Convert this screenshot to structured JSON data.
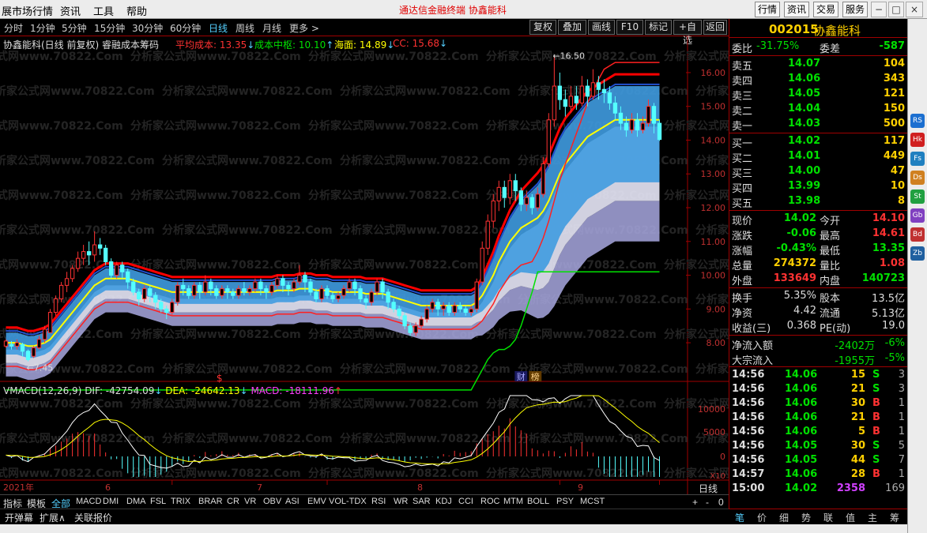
{
  "menu": {
    "items": [
      "展市场行情",
      "资讯",
      "工具",
      "帮助"
    ],
    "center_title": "通达信金融终端    协鑫能科",
    "right_buttons": [
      "行情",
      "资讯",
      "交易",
      "服务"
    ],
    "window_buttons": [
      "−",
      "□",
      "×"
    ]
  },
  "periods": {
    "items": [
      "分时",
      "1分钟",
      "5分钟",
      "15分钟",
      "30分钟",
      "60分钟",
      "日线",
      "周线",
      "月线",
      "更多 >"
    ],
    "active": "日线"
  },
  "toolbar": [
    "复权",
    "叠加",
    "画线",
    "F10",
    "标记",
    "+自选",
    "返回"
  ],
  "chart_header": {
    "title": "协鑫能科(日线 前复权) 睿融成本筹码",
    "avg_cost": "平均成本: 13.35",
    "cost_center": "成本中枢: 10.10",
    "sea": "海面: 14.89",
    "cc": "CC: 15.68"
  },
  "price_axis": [
    "16.00",
    "15.00",
    "14.00",
    "13.00",
    "12.00",
    "11.00",
    "10.00",
    "9.00",
    "8.00"
  ],
  "macd_axis": [
    "10000",
    "5000",
    "0"
  ],
  "macd_axis_unit": "X10",
  "annotations": {
    "high": "16.50",
    "low": "7.45",
    "dollar": "$",
    "badge_cai": "财",
    "badge_bang": "榜"
  },
  "x_labels": {
    "year": "2021年",
    "months": [
      "6",
      "7",
      "8",
      "9"
    ],
    "period": "日线"
  },
  "macd_header": {
    "name": "VMACD(12,26,9)",
    "dif": "DIF: -42754.09",
    "dea": "DEA: -24642.13",
    "macd": "MACD: -18111.96"
  },
  "watermark": "分析家公式网www.70822.Com",
  "colors": {
    "up": "#ff3232",
    "down": "#54ffff",
    "yellow": "#ffff00",
    "green_line": "#00e000",
    "red_line": "#ff0000",
    "blue_band": "#3f9be0",
    "lavender": "#a8a8e0",
    "accent_yellow": "#ffd000",
    "panel_border": "#a00000"
  },
  "chart_data": {
    "type": "candlestick",
    "ylim": [
      7.3,
      16.7
    ],
    "candles": [
      [
        7.9,
        8.05,
        7.85,
        8.1
      ],
      [
        7.95,
        7.9,
        7.8,
        8.05
      ],
      [
        7.9,
        8.0,
        7.8,
        8.1
      ],
      [
        7.95,
        7.75,
        7.6,
        8.0
      ],
      [
        7.75,
        7.5,
        7.45,
        7.8
      ],
      [
        7.6,
        7.85,
        7.55,
        7.9
      ],
      [
        7.85,
        8.1,
        7.8,
        8.2
      ],
      [
        8.1,
        8.4,
        8.0,
        8.5
      ],
      [
        8.3,
        8.9,
        8.3,
        9.0
      ],
      [
        8.9,
        9.3,
        8.8,
        9.4
      ],
      [
        9.3,
        9.7,
        9.2,
        9.8
      ],
      [
        9.7,
        9.9,
        9.5,
        10.1
      ],
      [
        9.9,
        10.2,
        9.8,
        10.3
      ],
      [
        10.2,
        10.5,
        10.1,
        10.7
      ],
      [
        10.5,
        10.7,
        10.3,
        10.9
      ],
      [
        10.7,
        10.6,
        10.3,
        11.0
      ],
      [
        10.6,
        10.9,
        10.4,
        11.3
      ],
      [
        10.9,
        10.8,
        10.6,
        11.1
      ],
      [
        10.8,
        10.4,
        10.3,
        10.9
      ],
      [
        10.4,
        10.0,
        9.9,
        10.5
      ],
      [
        10.0,
        10.3,
        9.9,
        10.4
      ],
      [
        10.3,
        10.1,
        9.9,
        10.4
      ],
      [
        10.1,
        9.8,
        9.6,
        10.2
      ],
      [
        9.8,
        9.5,
        9.4,
        9.9
      ],
      [
        9.5,
        9.3,
        9.1,
        9.6
      ],
      [
        9.3,
        9.6,
        9.2,
        9.7
      ],
      [
        9.6,
        9.4,
        9.2,
        9.7
      ],
      [
        9.4,
        9.2,
        9.0,
        9.5
      ],
      [
        9.2,
        9.0,
        8.9,
        9.3
      ],
      [
        9.0,
        8.9,
        8.7,
        9.1
      ],
      [
        8.9,
        9.2,
        8.8,
        9.3
      ],
      [
        9.2,
        9.7,
        9.1,
        9.8
      ],
      [
        9.7,
        9.6,
        9.4,
        9.9
      ],
      [
        9.6,
        9.4,
        9.3,
        9.7
      ],
      [
        9.4,
        9.7,
        9.3,
        9.8
      ],
      [
        9.7,
        9.5,
        9.3,
        9.8
      ],
      [
        9.5,
        9.8,
        9.4,
        10.0
      ],
      [
        9.8,
        9.6,
        9.4,
        9.9
      ],
      [
        9.6,
        9.4,
        9.3,
        9.7
      ],
      [
        9.4,
        9.6,
        9.3,
        9.7
      ],
      [
        9.6,
        9.5,
        9.3,
        9.7
      ],
      [
        9.5,
        9.4,
        9.3,
        9.6
      ],
      [
        9.4,
        9.6,
        9.3,
        9.7
      ],
      [
        9.6,
        9.5,
        9.4,
        9.8
      ],
      [
        9.5,
        9.6,
        9.4,
        9.7
      ],
      [
        9.6,
        9.8,
        9.5,
        9.9
      ],
      [
        9.8,
        9.6,
        9.4,
        9.9
      ],
      [
        9.6,
        9.5,
        9.3,
        9.7
      ],
      [
        9.5,
        9.7,
        9.4,
        9.8
      ],
      [
        9.7,
        9.9,
        9.6,
        10.0
      ],
      [
        9.9,
        9.7,
        9.5,
        10.0
      ],
      [
        9.7,
        9.6,
        9.4,
        9.8
      ],
      [
        9.6,
        9.8,
        9.5,
        9.9
      ],
      [
        9.8,
        10.0,
        9.7,
        10.3
      ],
      [
        10.0,
        9.8,
        9.5,
        10.1
      ],
      [
        9.8,
        9.5,
        9.4,
        9.9
      ],
      [
        9.5,
        9.3,
        9.2,
        9.6
      ],
      [
        9.3,
        9.6,
        9.2,
        9.7
      ],
      [
        9.6,
        9.4,
        9.3,
        9.7
      ],
      [
        9.4,
        9.3,
        9.2,
        9.5
      ],
      [
        9.3,
        9.4,
        9.2,
        9.5
      ],
      [
        9.4,
        9.6,
        9.3,
        9.7
      ],
      [
        9.6,
        9.8,
        9.5,
        9.9
      ],
      [
        9.8,
        9.6,
        9.4,
        9.9
      ],
      [
        9.6,
        9.3,
        9.2,
        9.7
      ],
      [
        9.3,
        9.2,
        9.0,
        9.4
      ],
      [
        9.2,
        9.5,
        9.1,
        9.6
      ],
      [
        9.5,
        9.8,
        9.4,
        9.9
      ],
      [
        9.8,
        9.5,
        9.3,
        9.9
      ],
      [
        9.5,
        9.2,
        9.0,
        9.6
      ],
      [
        9.2,
        9.0,
        8.9,
        9.3
      ],
      [
        9.0,
        8.8,
        8.7,
        9.1
      ],
      [
        8.8,
        8.5,
        8.4,
        8.9
      ],
      [
        8.5,
        8.3,
        8.2,
        8.6
      ],
      [
        8.3,
        8.5,
        8.2,
        8.6
      ],
      [
        8.5,
        8.7,
        8.4,
        8.8
      ],
      [
        8.7,
        9.0,
        8.6,
        9.1
      ],
      [
        9.0,
        9.2,
        8.9,
        9.3
      ],
      [
        9.2,
        9.0,
        8.8,
        9.3
      ],
      [
        9.0,
        9.1,
        8.8,
        9.2
      ],
      [
        9.1,
        8.9,
        8.8,
        9.2
      ],
      [
        8.9,
        9.1,
        8.8,
        9.2
      ],
      [
        9.1,
        9.0,
        8.9,
        9.2
      ],
      [
        9.0,
        8.9,
        8.8,
        9.1
      ],
      [
        8.9,
        9.0,
        8.8,
        9.1
      ],
      [
        9.0,
        9.8,
        8.9,
        9.9
      ],
      [
        9.8,
        10.8,
        9.7,
        11.0
      ],
      [
        10.8,
        11.6,
        10.6,
        11.8
      ],
      [
        11.6,
        12.2,
        11.4,
        12.4
      ],
      [
        12.2,
        12.6,
        11.9,
        12.8
      ],
      [
        12.6,
        12.3,
        12.0,
        12.8
      ],
      [
        12.3,
        12.8,
        12.1,
        13.0
      ],
      [
        12.8,
        12.5,
        12.2,
        13.0
      ],
      [
        12.5,
        12.1,
        11.9,
        12.6
      ],
      [
        12.1,
        12.3,
        11.9,
        12.5
      ],
      [
        12.3,
        12.0,
        11.8,
        12.4
      ],
      [
        12.0,
        12.4,
        11.9,
        12.6
      ],
      [
        12.4,
        13.3,
        12.3,
        13.5
      ],
      [
        13.3,
        14.6,
        13.2,
        14.8
      ],
      [
        14.6,
        15.6,
        14.4,
        16.5
      ],
      [
        15.6,
        15.2,
        14.9,
        16.0
      ],
      [
        15.2,
        15.0,
        14.7,
        15.5
      ],
      [
        15.0,
        15.3,
        14.8,
        15.6
      ],
      [
        15.3,
        15.1,
        14.9,
        15.6
      ],
      [
        15.1,
        15.6,
        15.0,
        15.9
      ],
      [
        15.6,
        15.3,
        15.0,
        15.8
      ],
      [
        15.3,
        15.7,
        15.2,
        16.1
      ],
      [
        15.7,
        15.5,
        15.2,
        15.9
      ],
      [
        15.5,
        15.4,
        15.1,
        15.8
      ],
      [
        15.4,
        15.1,
        14.9,
        15.6
      ],
      [
        15.1,
        14.8,
        14.6,
        15.3
      ],
      [
        14.8,
        14.5,
        14.3,
        15.0
      ],
      [
        14.5,
        14.3,
        14.1,
        14.7
      ],
      [
        14.3,
        14.6,
        14.2,
        14.8
      ],
      [
        14.6,
        14.3,
        14.1,
        14.8
      ],
      [
        14.3,
        14.5,
        14.2,
        14.7
      ],
      [
        14.5,
        15.0,
        14.4,
        15.2
      ],
      [
        15.0,
        14.5,
        14.2,
        15.1
      ],
      [
        14.5,
        14.02,
        13.98,
        14.61
      ]
    ],
    "ma_yellow": [
      8.0,
      8.0,
      8.0,
      7.95,
      7.9,
      7.9,
      7.95,
      8.0,
      8.1,
      8.3,
      8.5,
      8.7,
      8.9,
      9.1,
      9.3,
      9.5,
      9.7,
      9.8,
      9.9,
      9.9,
      9.9,
      9.9,
      9.9,
      9.85,
      9.8,
      9.75,
      9.7,
      9.65,
      9.6,
      9.55,
      9.5,
      9.5,
      9.5,
      9.5,
      9.5,
      9.5,
      9.5,
      9.5,
      9.5,
      9.5,
      9.5,
      9.5,
      9.5,
      9.5,
      9.5,
      9.5,
      9.5,
      9.5,
      9.5,
      9.55,
      9.55,
      9.55,
      9.55,
      9.6,
      9.6,
      9.6,
      9.55,
      9.55,
      9.55,
      9.5,
      9.5,
      9.5,
      9.5,
      9.5,
      9.5,
      9.45,
      9.45,
      9.45,
      9.45,
      9.4,
      9.35,
      9.3,
      9.25,
      9.2,
      9.15,
      9.1,
      9.1,
      9.1,
      9.1,
      9.1,
      9.1,
      9.1,
      9.1,
      9.1,
      9.1,
      9.2,
      9.4,
      9.7,
      10.0,
      10.4,
      10.7,
      11.0,
      11.2,
      11.4,
      11.5,
      11.6,
      11.7,
      11.9,
      12.2,
      12.6,
      13.0,
      13.3,
      13.5,
      13.7,
      13.9,
      14.1,
      14.2,
      14.3,
      14.4,
      14.5,
      14.6,
      14.6,
      14.6,
      14.6,
      14.6,
      14.6,
      14.6,
      14.6,
      14.6
    ],
    "cost_center_line": [
      6.6,
      6.6,
      6.6,
      6.6,
      6.6,
      6.6,
      6.6,
      6.6,
      6.6,
      6.6,
      6.6,
      6.6,
      6.6,
      6.6,
      6.6,
      6.6,
      6.6,
      6.6,
      6.6,
      6.6,
      6.6,
      6.6,
      6.6,
      6.6,
      6.6,
      6.6,
      6.6,
      6.6,
      6.6,
      6.6,
      6.6,
      6.6,
      6.6,
      6.6,
      6.6,
      6.6,
      6.6,
      6.6,
      6.6,
      6.6,
      6.6,
      6.6,
      6.6,
      6.6,
      6.6,
      6.6,
      6.6,
      6.6,
      6.6,
      6.6,
      6.6,
      6.6,
      6.6,
      6.6,
      6.6,
      6.6,
      6.6,
      6.6,
      6.6,
      6.6,
      6.6,
      6.6,
      6.6,
      6.6,
      6.6,
      6.6,
      6.6,
      6.6,
      6.6,
      6.6,
      6.6,
      6.6,
      6.6,
      6.6,
      6.6,
      6.6,
      6.6,
      6.6,
      6.6,
      6.6,
      6.6,
      6.6,
      6.6,
      6.6,
      6.6,
      6.9,
      7.2,
      7.5,
      7.7,
      7.8,
      7.8,
      7.9,
      8.1,
      8.5,
      9.0,
      9.5,
      10.1,
      10.1,
      10.1,
      10.1,
      10.1,
      10.1,
      10.1,
      10.1,
      10.1,
      10.1,
      10.1,
      10.1,
      10.1,
      10.1,
      10.1,
      10.1,
      10.1,
      10.1,
      10.1,
      10.1,
      10.1,
      10.1,
      10.1
    ]
  },
  "quote": {
    "code": "002015",
    "name": "协鑫能科",
    "wei_bi_label": "委比",
    "wei_bi": "-31.75%",
    "wei_cha_label": "委差",
    "wei_cha": "-587",
    "asks": [
      {
        "label": "卖五",
        "price": "14.07",
        "vol": "104"
      },
      {
        "label": "卖四",
        "price": "14.06",
        "vol": "343"
      },
      {
        "label": "卖三",
        "price": "14.05",
        "vol": "121"
      },
      {
        "label": "卖二",
        "price": "14.04",
        "vol": "150"
      },
      {
        "label": "卖一",
        "price": "14.03",
        "vol": "500"
      }
    ],
    "bids": [
      {
        "label": "买一",
        "price": "14.02",
        "vol": "117"
      },
      {
        "label": "买二",
        "price": "14.01",
        "vol": "449"
      },
      {
        "label": "买三",
        "price": "14.00",
        "vol": "47"
      },
      {
        "label": "买四",
        "price": "13.99",
        "vol": "10"
      },
      {
        "label": "买五",
        "price": "13.98",
        "vol": "8"
      }
    ],
    "stats": [
      {
        "l1": "现价",
        "v1": "14.02",
        "c1": "#00e000",
        "l2": "今开",
        "v2": "14.10",
        "c2": "#ff3232"
      },
      {
        "l1": "涨跌",
        "v1": "-0.06",
        "c1": "#00e000",
        "l2": "最高",
        "v2": "14.61",
        "c2": "#ff3232"
      },
      {
        "l1": "涨幅",
        "v1": "-0.43%",
        "c1": "#00e000",
        "l2": "最低",
        "v2": "13.35",
        "c2": "#00e000"
      },
      {
        "l1": "总量",
        "v1": "274372",
        "c1": "#ffd000",
        "l2": "量比",
        "v2": "1.08",
        "c2": "#ff3232"
      },
      {
        "l1": "外盘",
        "v1": "133649",
        "c1": "#ff3232",
        "l2": "内盘",
        "v2": "140723",
        "c2": "#00e000"
      }
    ],
    "stats2": [
      {
        "l1": "换手",
        "v1": "5.35%",
        "l2": "股本",
        "v2": "13.5亿"
      },
      {
        "l1": "净资",
        "v1": "4.42",
        "l2": "流通",
        "v2": "5.13亿"
      },
      {
        "l1": "收益(三)",
        "v1": "0.368",
        "l2": "PE(动)",
        "v2": "19.0"
      }
    ],
    "flows": [
      {
        "label": "净流入额",
        "val": "-2402万",
        "pct": "-6%"
      },
      {
        "label": "大宗流入",
        "val": "-1955万",
        "pct": "-5%"
      }
    ],
    "ticks": [
      {
        "t": "14:56",
        "p": "14.06",
        "v": "15",
        "d": "S",
        "n": "3"
      },
      {
        "t": "14:56",
        "p": "14.06",
        "v": "21",
        "d": "S",
        "n": "3"
      },
      {
        "t": "14:56",
        "p": "14.06",
        "v": "30",
        "d": "B",
        "n": "1"
      },
      {
        "t": "14:56",
        "p": "14.06",
        "v": "21",
        "d": "B",
        "n": "1"
      },
      {
        "t": "14:56",
        "p": "14.06",
        "v": "5",
        "d": "B",
        "n": "1"
      },
      {
        "t": "14:56",
        "p": "14.05",
        "v": "30",
        "d": "S",
        "n": "5"
      },
      {
        "t": "14:56",
        "p": "14.05",
        "v": "44",
        "d": "S",
        "n": "7"
      },
      {
        "t": "14:57",
        "p": "14.06",
        "v": "28",
        "d": "B",
        "n": "1"
      },
      {
        "t": "15:00",
        "p": "14.02",
        "v": "2358",
        "d": "",
        "n": "169"
      }
    ]
  },
  "indicator_tabs": {
    "first": [
      "指标",
      "模板",
      "全部"
    ],
    "items": [
      "MACD",
      "DMI",
      "DMA",
      "FSL",
      "TRIX",
      "BRAR",
      "CR",
      "VR",
      "OBV",
      "ASI",
      "EMV",
      "VOL-TDX",
      "RSI",
      "WR",
      "SAR",
      "KDJ",
      "CCI",
      "ROC",
      "MTM",
      "BOLL",
      "PSY",
      "MCST"
    ],
    "zoom": [
      "+",
      "-",
      "0"
    ]
  },
  "bottom_bar": [
    "开弹幕",
    "扩展∧",
    "关联报价"
  ],
  "right_bottom_tabs": [
    "笔",
    "价",
    "细",
    "势",
    "联",
    "值",
    "主",
    "筹"
  ],
  "sidebar_icons": [
    "RS",
    "Hk",
    "Fs",
    "Ds",
    "St",
    "Gb",
    "Bd",
    "Zb"
  ]
}
